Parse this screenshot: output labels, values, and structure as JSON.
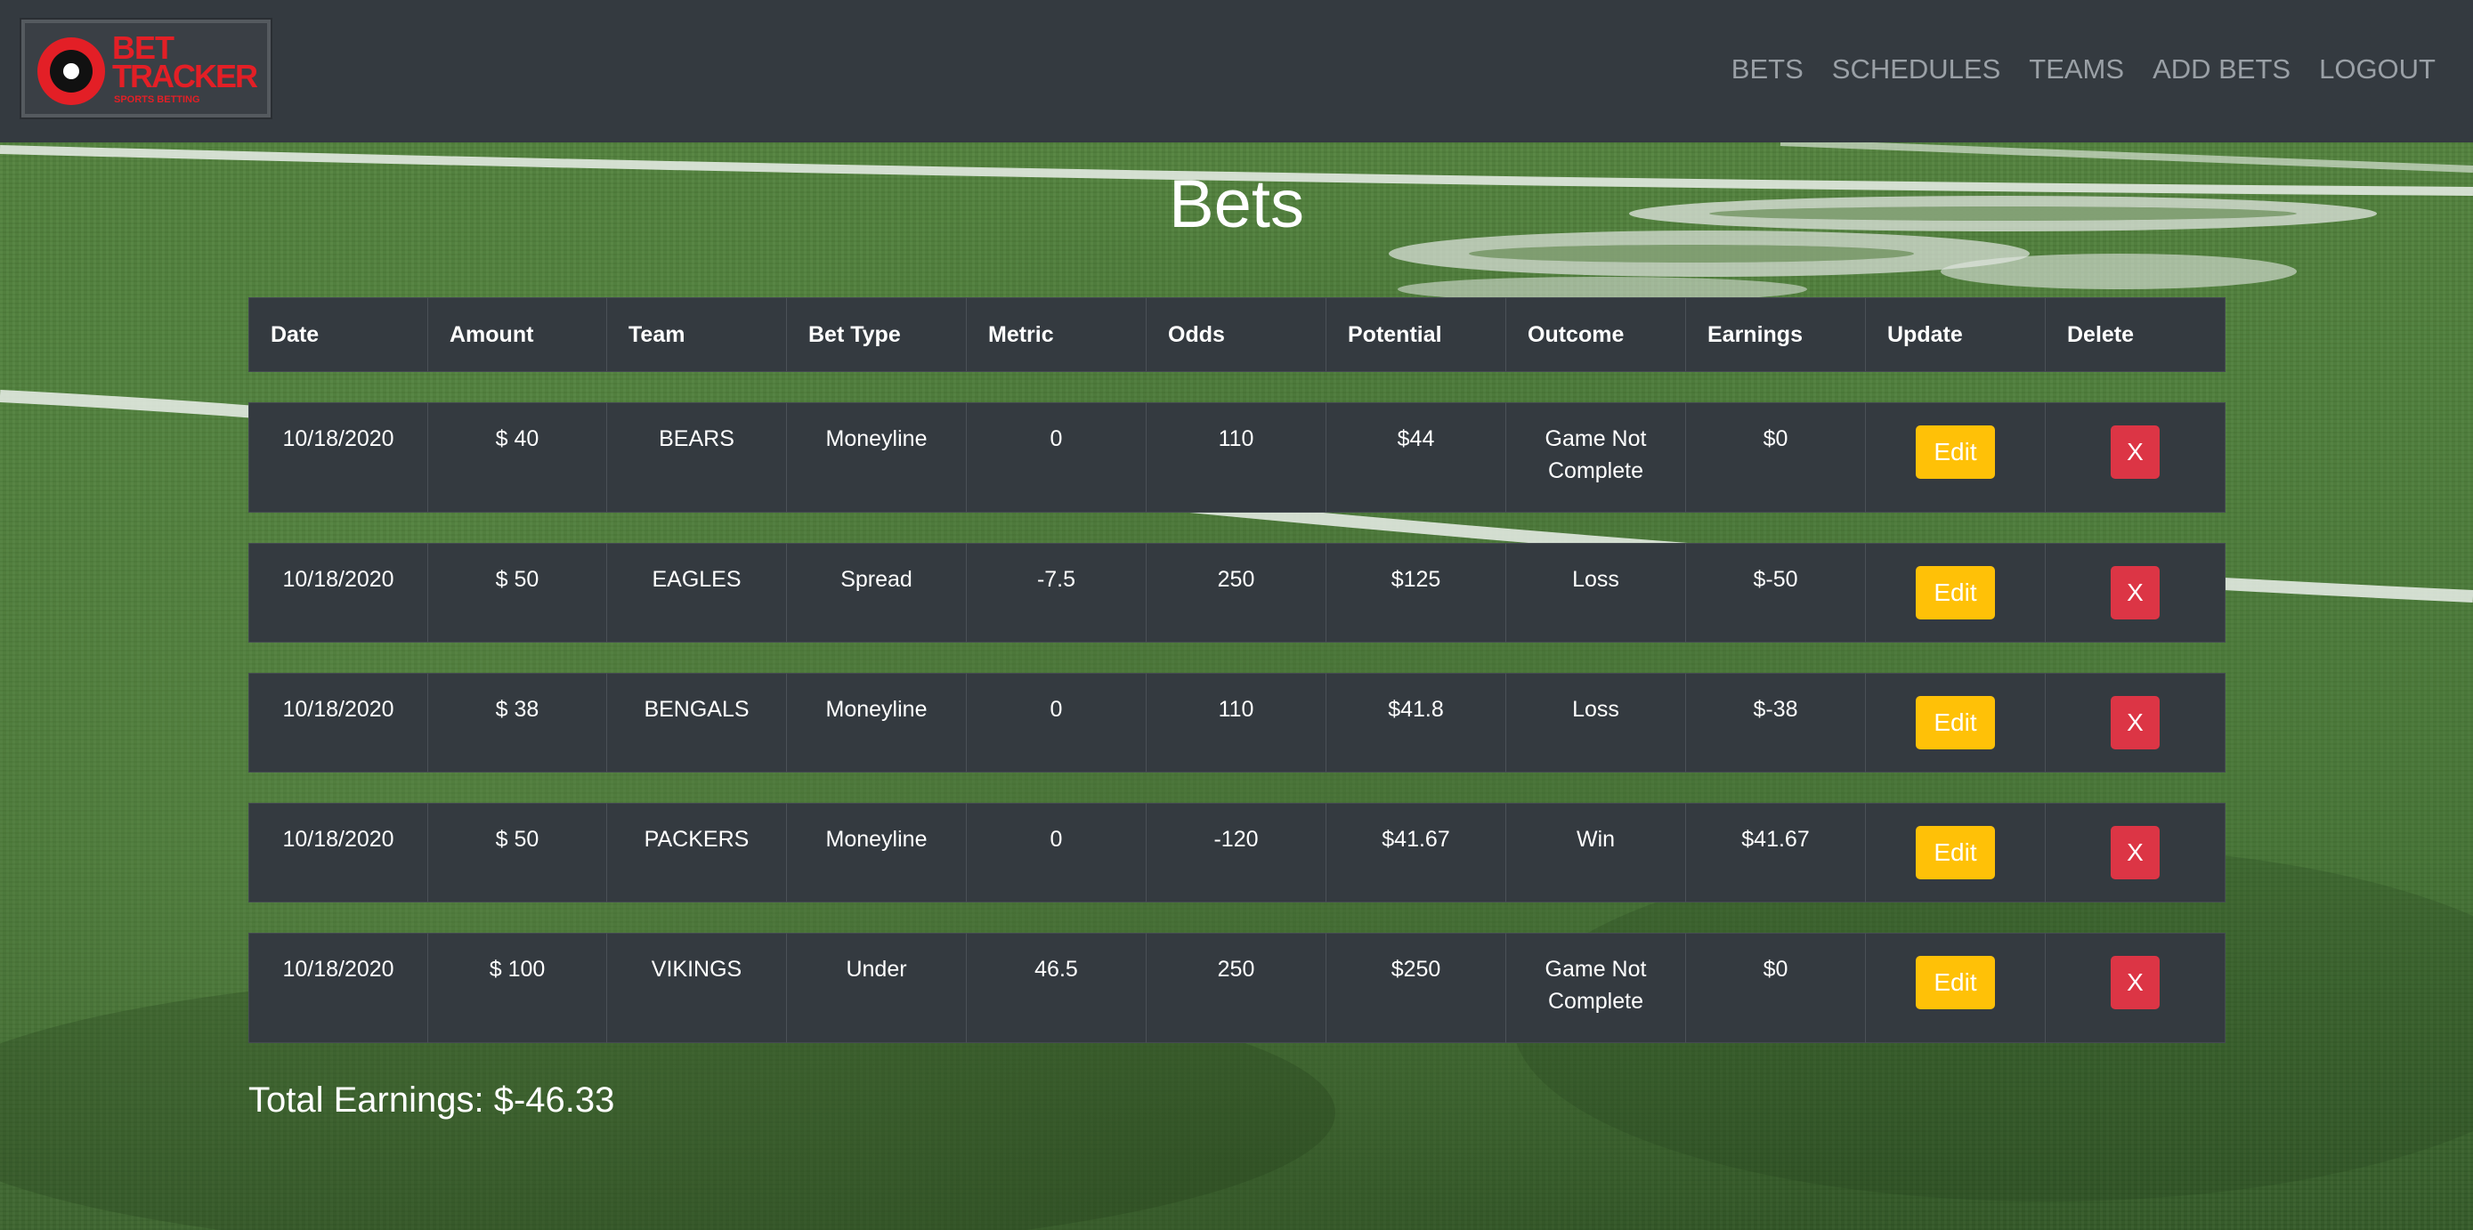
{
  "brand": {
    "line1": "BET",
    "line2": "TRACKER",
    "tagline": "SPORTS BETTING"
  },
  "nav": {
    "links": [
      "BETS",
      "SCHEDULES",
      "TEAMS",
      "ADD BETS",
      "LOGOUT"
    ]
  },
  "page": {
    "title": "Bets"
  },
  "table": {
    "headers": [
      "Date",
      "Amount",
      "Team",
      "Bet Type",
      "Metric",
      "Odds",
      "Potential",
      "Outcome",
      "Earnings",
      "Update",
      "Delete"
    ],
    "rows": [
      {
        "date": "10/18/2020",
        "amount": "$ 40",
        "team": "BEARS",
        "bet_type": "Moneyline",
        "metric": "0",
        "odds": "110",
        "potential": "$44",
        "outcome": "Game Not Complete",
        "earnings": "$0",
        "edit_label": "Edit",
        "delete_label": "X"
      },
      {
        "date": "10/18/2020",
        "amount": "$ 50",
        "team": "EAGLES",
        "bet_type": "Spread",
        "metric": "-7.5",
        "odds": "250",
        "potential": "$125",
        "outcome": "Loss",
        "earnings": "$-50",
        "edit_label": "Edit",
        "delete_label": "X"
      },
      {
        "date": "10/18/2020",
        "amount": "$ 38",
        "team": "BENGALS",
        "bet_type": "Moneyline",
        "metric": "0",
        "odds": "110",
        "potential": "$41.8",
        "outcome": "Loss",
        "earnings": "$-38",
        "edit_label": "Edit",
        "delete_label": "X"
      },
      {
        "date": "10/18/2020",
        "amount": "$ 50",
        "team": "PACKERS",
        "bet_type": "Moneyline",
        "metric": "0",
        "odds": "-120",
        "potential": "$41.67",
        "outcome": "Win",
        "earnings": "$41.67",
        "edit_label": "Edit",
        "delete_label": "X"
      },
      {
        "date": "10/18/2020",
        "amount": "$ 100",
        "team": "VIKINGS",
        "bet_type": "Under",
        "metric": "46.5",
        "odds": "250",
        "potential": "$250",
        "outcome": "Game Not Complete",
        "earnings": "$0",
        "edit_label": "Edit",
        "delete_label": "X"
      }
    ]
  },
  "summary": {
    "total_earnings": "Total Earnings: $-46.33"
  },
  "colors": {
    "navbar": "#343a40",
    "brand_red": "#e31f26",
    "edit_button": "#ffc107",
    "delete_button": "#dc3545",
    "field_green": "#4d7c3a"
  }
}
